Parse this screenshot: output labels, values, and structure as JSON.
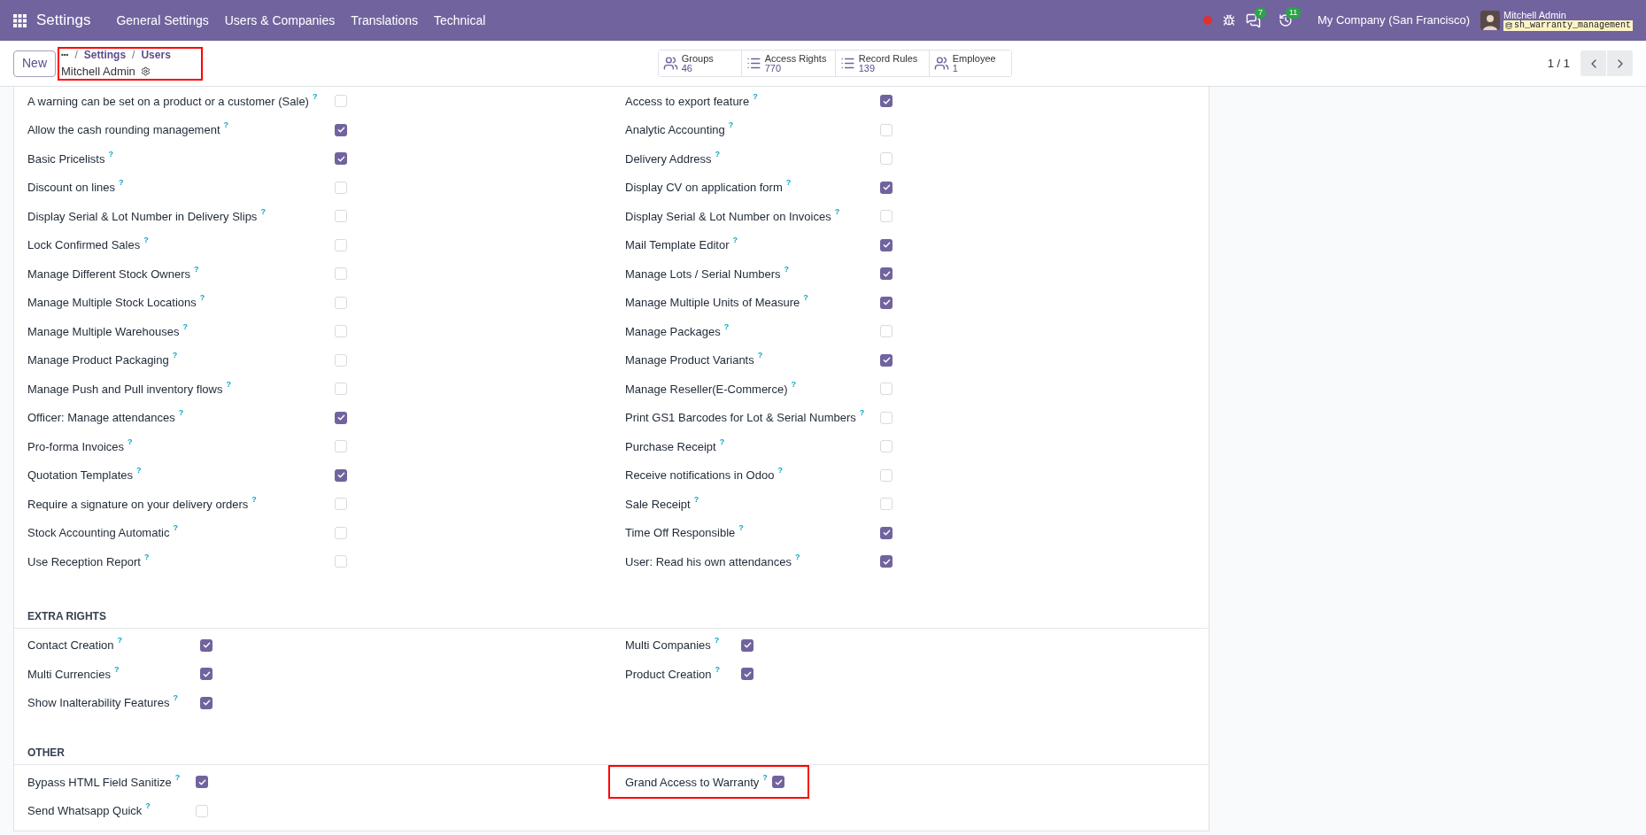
{
  "navbar": {
    "app": "Settings",
    "menu": [
      "General Settings",
      "Users & Companies",
      "Translations",
      "Technical"
    ],
    "chat_count": "7",
    "activity_count": "11",
    "company": "My Company (San Francisco)",
    "user": "Mitchell Admin",
    "database": "sh_warranty_management"
  },
  "control_panel": {
    "new_button": "New",
    "breadcrumb_more": "•••",
    "breadcrumb": [
      {
        "separator": "/",
        "label": "Settings"
      },
      {
        "separator": "/",
        "label": "Users"
      }
    ],
    "record": "Mitchell Admin",
    "highlighted": true,
    "smart_buttons": [
      {
        "label": "Groups",
        "count": "46",
        "kind": "users"
      },
      {
        "label": "Access Rights",
        "count": "770",
        "kind": "list"
      },
      {
        "label": "Record Rules",
        "count": "139",
        "kind": "list"
      },
      {
        "label": "Employee",
        "count": "1",
        "kind": "users"
      }
    ],
    "pager": "1 / 1"
  },
  "sections": [
    {
      "left": [
        {
          "label": "A warning can be set on a product or a customer (Sale)",
          "help": "?",
          "checked": false
        },
        {
          "label": "Allow the cash rounding management",
          "help": "?",
          "checked": true
        },
        {
          "label": "Basic Pricelists",
          "help": "?",
          "checked": true
        },
        {
          "label": "Discount on lines",
          "help": "?",
          "checked": false
        },
        {
          "label": "Display Serial & Lot Number in Delivery Slips",
          "help": "?",
          "checked": false
        },
        {
          "label": "Lock Confirmed Sales",
          "help": "?",
          "checked": false
        },
        {
          "label": "Manage Different Stock Owners",
          "help": "?",
          "checked": false
        },
        {
          "label": "Manage Multiple Stock Locations",
          "help": "?",
          "checked": false
        },
        {
          "label": "Manage Multiple Warehouses",
          "help": "?",
          "checked": false
        },
        {
          "label": "Manage Product Packaging",
          "help": "?",
          "checked": false
        },
        {
          "label": "Manage Push and Pull inventory flows",
          "help": "?",
          "checked": false
        },
        {
          "label": "Officer: Manage attendances",
          "help": "?",
          "checked": true
        },
        {
          "label": "Pro-forma Invoices",
          "help": "?",
          "checked": false
        },
        {
          "label": "Quotation Templates",
          "help": "?",
          "checked": true
        },
        {
          "label": "Require a signature on your delivery orders",
          "help": "?",
          "checked": false
        },
        {
          "label": "Stock Accounting Automatic",
          "help": "?",
          "checked": false
        },
        {
          "label": "Use Reception Report",
          "help": "?",
          "checked": false
        }
      ],
      "right": [
        {
          "label": "Access to export feature",
          "help": "?",
          "checked": true
        },
        {
          "label": "Analytic Accounting",
          "help": "?",
          "checked": false
        },
        {
          "label": "Delivery Address",
          "help": "?",
          "checked": false
        },
        {
          "label": "Display CV on application form",
          "help": "?",
          "checked": true
        },
        {
          "label": "Display Serial & Lot Number on Invoices",
          "help": "?",
          "checked": false
        },
        {
          "label": "Mail Template Editor",
          "help": "?",
          "checked": true
        },
        {
          "label": "Manage Lots / Serial Numbers",
          "help": "?",
          "checked": true
        },
        {
          "label": "Manage Multiple Units of Measure",
          "help": "?",
          "checked": true
        },
        {
          "label": "Manage Packages",
          "help": "?",
          "checked": false
        },
        {
          "label": "Manage Product Variants",
          "help": "?",
          "checked": true
        },
        {
          "label": "Manage Reseller(E-Commerce)",
          "help": "?",
          "checked": false
        },
        {
          "label": "Print GS1 Barcodes for Lot & Serial Numbers",
          "help": "?",
          "checked": false
        },
        {
          "label": "Purchase Receipt",
          "help": "?",
          "checked": false
        },
        {
          "label": "Receive notifications in Odoo",
          "help": "?",
          "checked": false
        },
        {
          "label": "Sale Receipt",
          "help": "?",
          "checked": false
        },
        {
          "label": "Time Off Responsible",
          "help": "?",
          "checked": true
        },
        {
          "label": "User: Read his own attendances",
          "help": "?",
          "checked": true
        }
      ]
    },
    {
      "title": "EXTRA RIGHTS",
      "left": [
        {
          "label": "Contact Creation",
          "help": "?",
          "checked": true
        },
        {
          "label": "Multi Currencies",
          "help": "?",
          "checked": true
        },
        {
          "label": "Show Inalterability Features",
          "help": "?",
          "checked": true
        }
      ],
      "right": [
        {
          "label": "Multi Companies",
          "help": "?",
          "checked": true
        },
        {
          "label": "Product Creation",
          "help": "?",
          "checked": true
        }
      ]
    },
    {
      "title": "OTHER",
      "left": [
        {
          "label": "Bypass HTML Field Sanitize",
          "help": "?",
          "checked": true,
          "highlighted": false
        },
        {
          "label": "Send Whatsapp Quick",
          "help": "?",
          "checked": false,
          "highlighted": false
        }
      ],
      "right": [
        {
          "label": "Grand Access to Warranty",
          "help": "?",
          "checked": true,
          "highlighted": true
        }
      ]
    }
  ]
}
